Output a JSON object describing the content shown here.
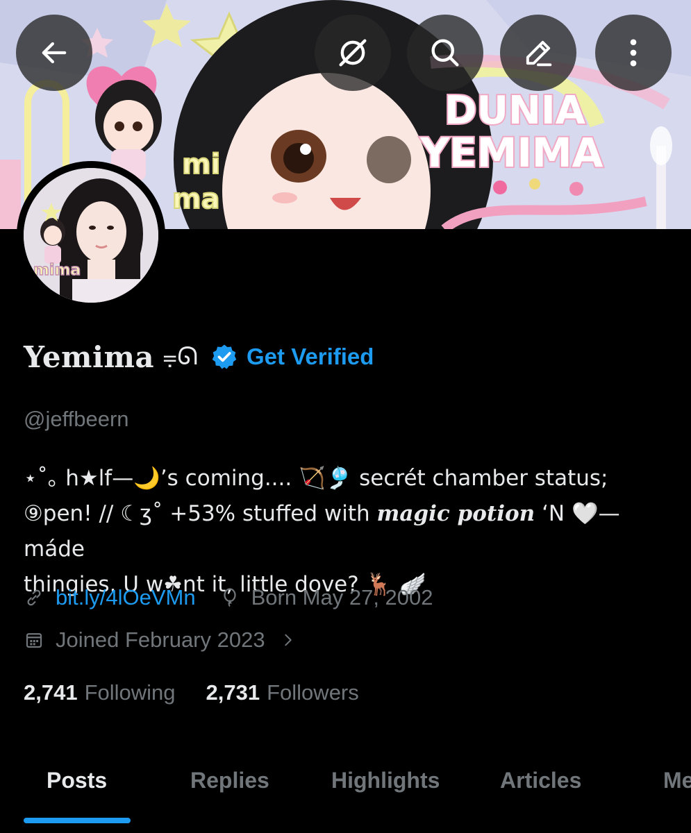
{
  "banner": {
    "title_line1": "DUNIA",
    "title_line2": "YEMIMA",
    "side_text_1": "mi",
    "side_text_2": "ma"
  },
  "header_buttons": {
    "back": "back-arrow-icon",
    "private": "eye-slash-icon",
    "search": "search-icon",
    "edit": "pencil-icon",
    "more": "more-vertical-icon"
  },
  "avatar": {
    "badge_text": "mima"
  },
  "profile": {
    "display_name": "Yemima",
    "name_decoration": "⩦ᘏ",
    "verify_label": "Get Verified",
    "handle": "@jeffbeern",
    "bio_line1": "⋆˚｡ h★lf—🌙’s coming.... 🏹🎐 secrét chamber status;",
    "bio_line2_a": "⑨pen! // ☾ʒ˚ +53% stuffed with ",
    "bio_line2_italic": "magic potion",
    "bio_line2_b": " ‘N 🤍—máde",
    "bio_line3": "thingies. U w☘nt it, little dove? 🦌 🪽",
    "website": "bit.ly/4lOeVMn",
    "birthday": "Born May 27, 2002",
    "joined": "Joined February 2023"
  },
  "stats": {
    "following_count": "2,741",
    "following_label": "Following",
    "followers_count": "2,731",
    "followers_label": "Followers"
  },
  "tabs": [
    {
      "label": "Posts",
      "active": true
    },
    {
      "label": "Replies",
      "active": false
    },
    {
      "label": "Highlights",
      "active": false
    },
    {
      "label": "Articles",
      "active": false
    },
    {
      "label": "Me",
      "active": false
    }
  ],
  "colors": {
    "accent": "#1d9bf0",
    "text_primary": "#e7e9ea",
    "text_secondary": "#71767b",
    "background": "#000000"
  }
}
